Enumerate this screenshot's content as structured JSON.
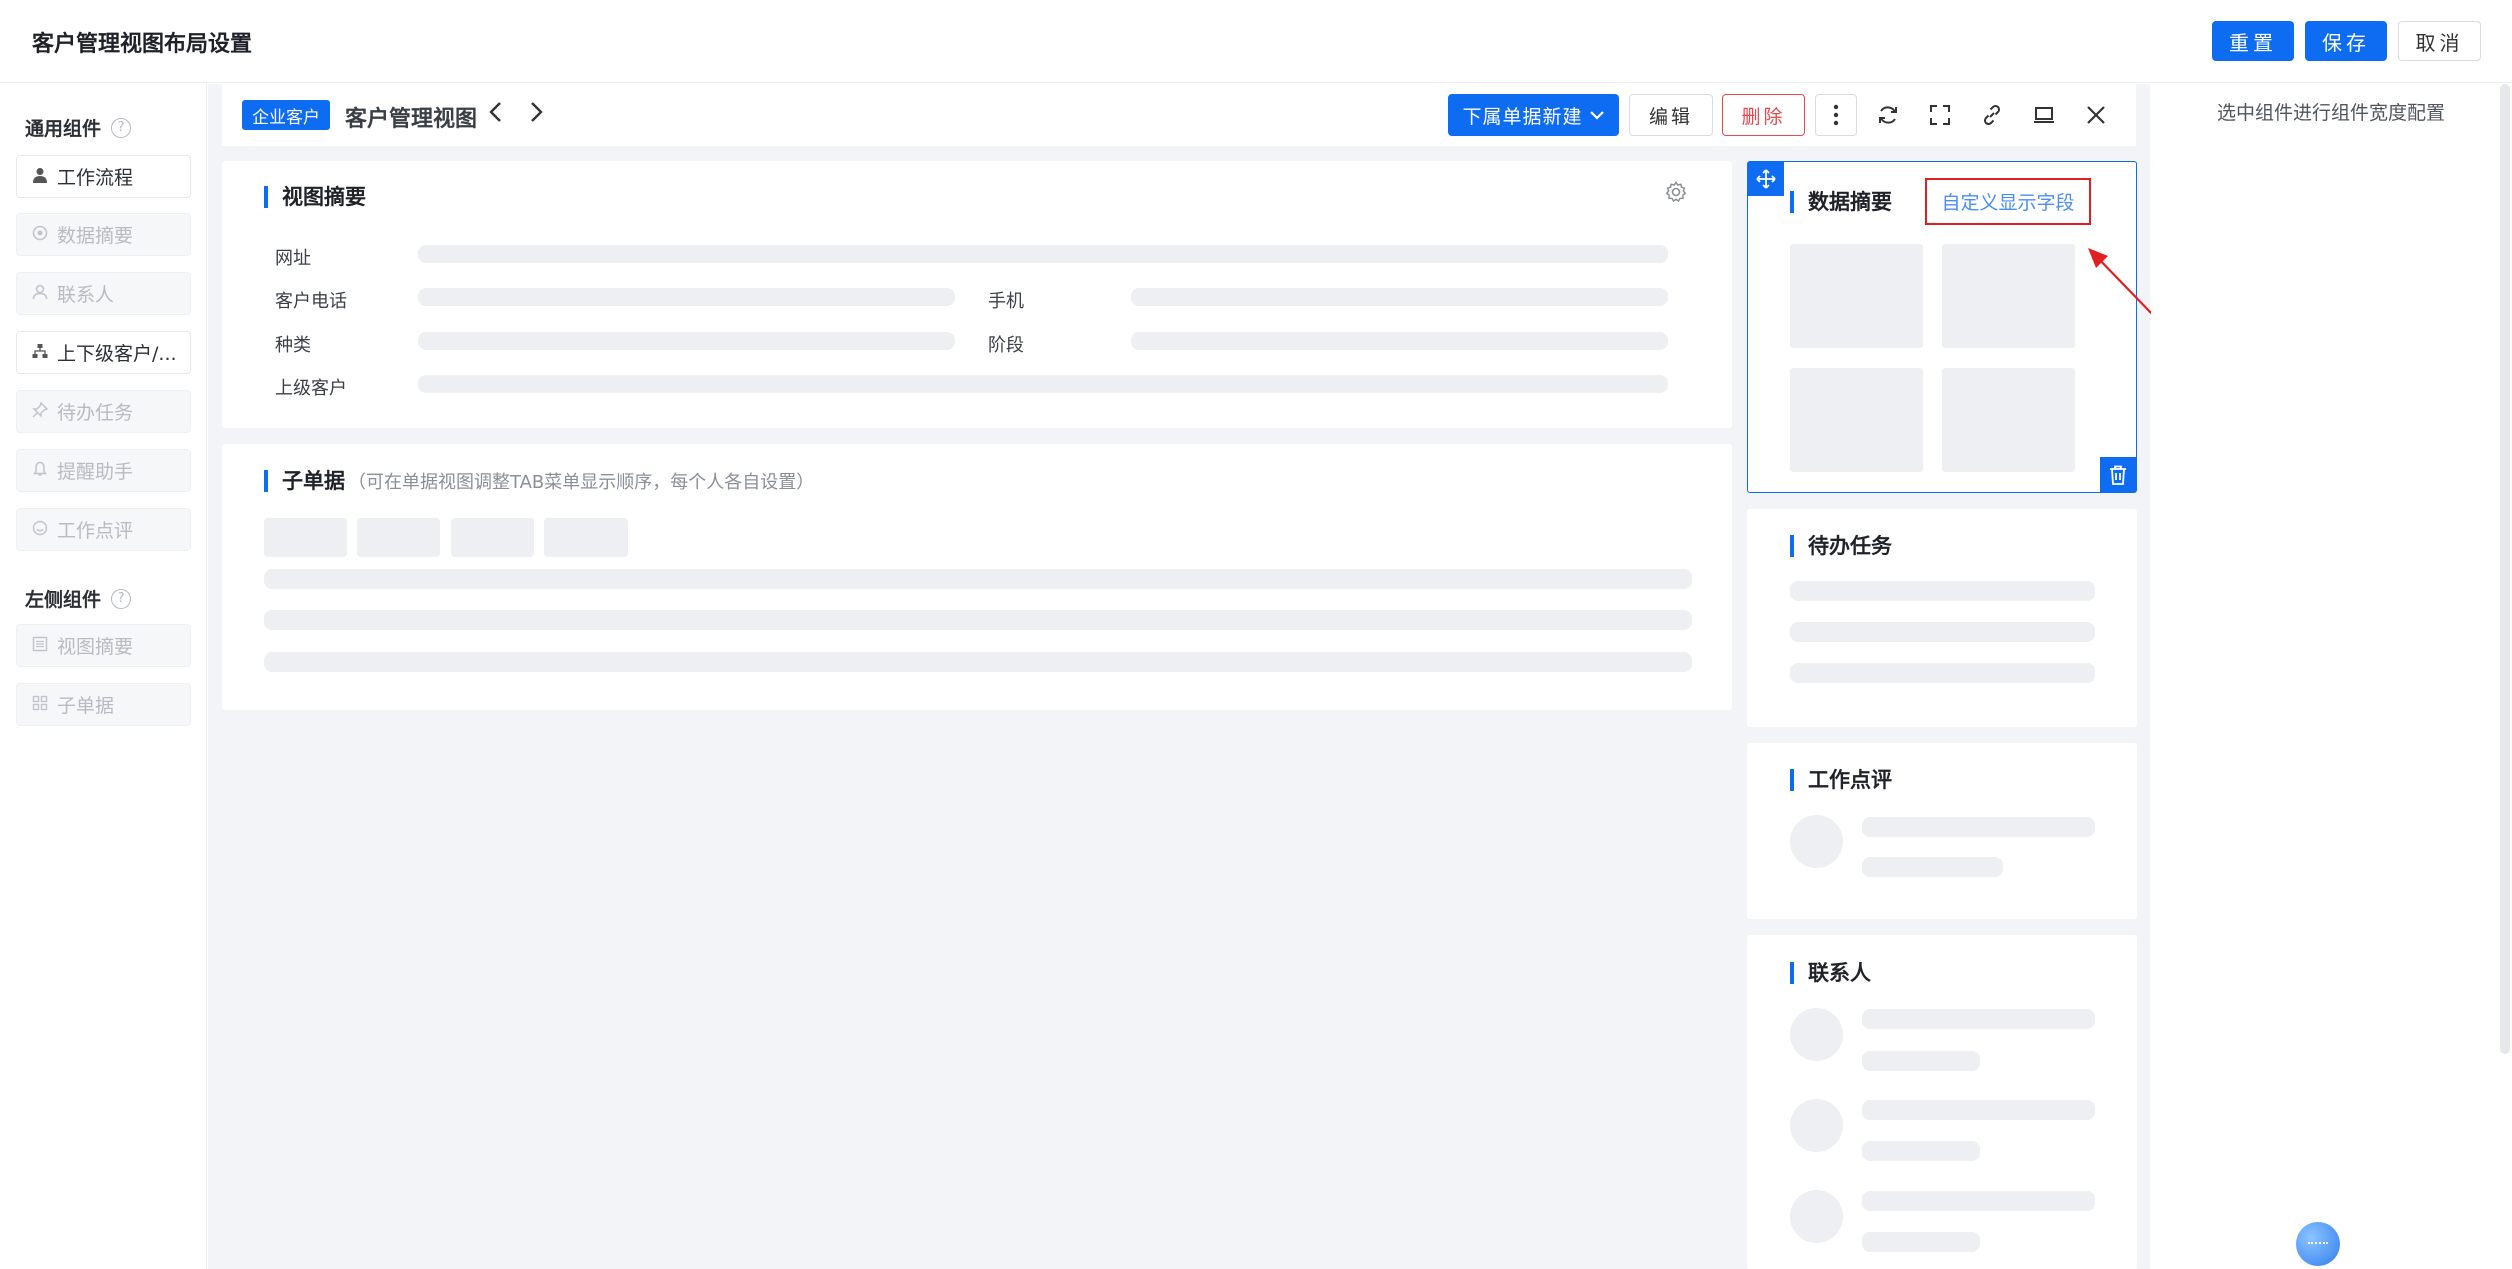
{
  "header": {
    "title": "客户管理视图布局设置",
    "reset_label": "重置",
    "save_label": "保存",
    "cancel_label": "取消"
  },
  "palette": {
    "general_title": "通用组件",
    "general_items": [
      {
        "label": "工作流程",
        "icon": "user-icon",
        "enabled": true
      },
      {
        "label": "数据摘要",
        "icon": "eye-icon",
        "enabled": false
      },
      {
        "label": "联系人",
        "icon": "person-icon",
        "enabled": false
      },
      {
        "label": "上下级客户/...",
        "icon": "hierarchy-icon",
        "enabled": true
      },
      {
        "label": "待办任务",
        "icon": "pin-icon",
        "enabled": false
      },
      {
        "label": "提醒助手",
        "icon": "bell-icon",
        "enabled": false
      },
      {
        "label": "工作点评",
        "icon": "comment-icon",
        "enabled": false
      }
    ],
    "left_title": "左侧组件",
    "left_items": [
      {
        "label": "视图摘要",
        "icon": "doc-icon",
        "enabled": false
      },
      {
        "label": "子单据",
        "icon": "grid-icon",
        "enabled": false
      }
    ]
  },
  "view_header": {
    "tag": "企业客户",
    "title": "客户管理视图",
    "sub_create_label": "下属单据新建",
    "edit_label": "编辑",
    "delete_label": "删除"
  },
  "summary_card": {
    "title": "视图摘要",
    "fields": [
      "网址",
      "客户电话",
      "手机",
      "种类",
      "阶段",
      "上级客户"
    ]
  },
  "child_card": {
    "title": "子单据",
    "hint": "（可在单据视图调整TAB菜单显示顺序，每个人各自设置）"
  },
  "data_summary_card": {
    "title": "数据摘要",
    "custom_fields_label": "自定义显示字段"
  },
  "todo_card": {
    "title": "待办任务"
  },
  "review_card": {
    "title": "工作点评"
  },
  "contacts_card": {
    "title": "联系人"
  },
  "config_panel": {
    "hint": "选中组件进行组件宽度配置"
  },
  "colors": {
    "accent": "#0d6cf2",
    "danger": "#e5484d",
    "annotation": "#e02020"
  }
}
